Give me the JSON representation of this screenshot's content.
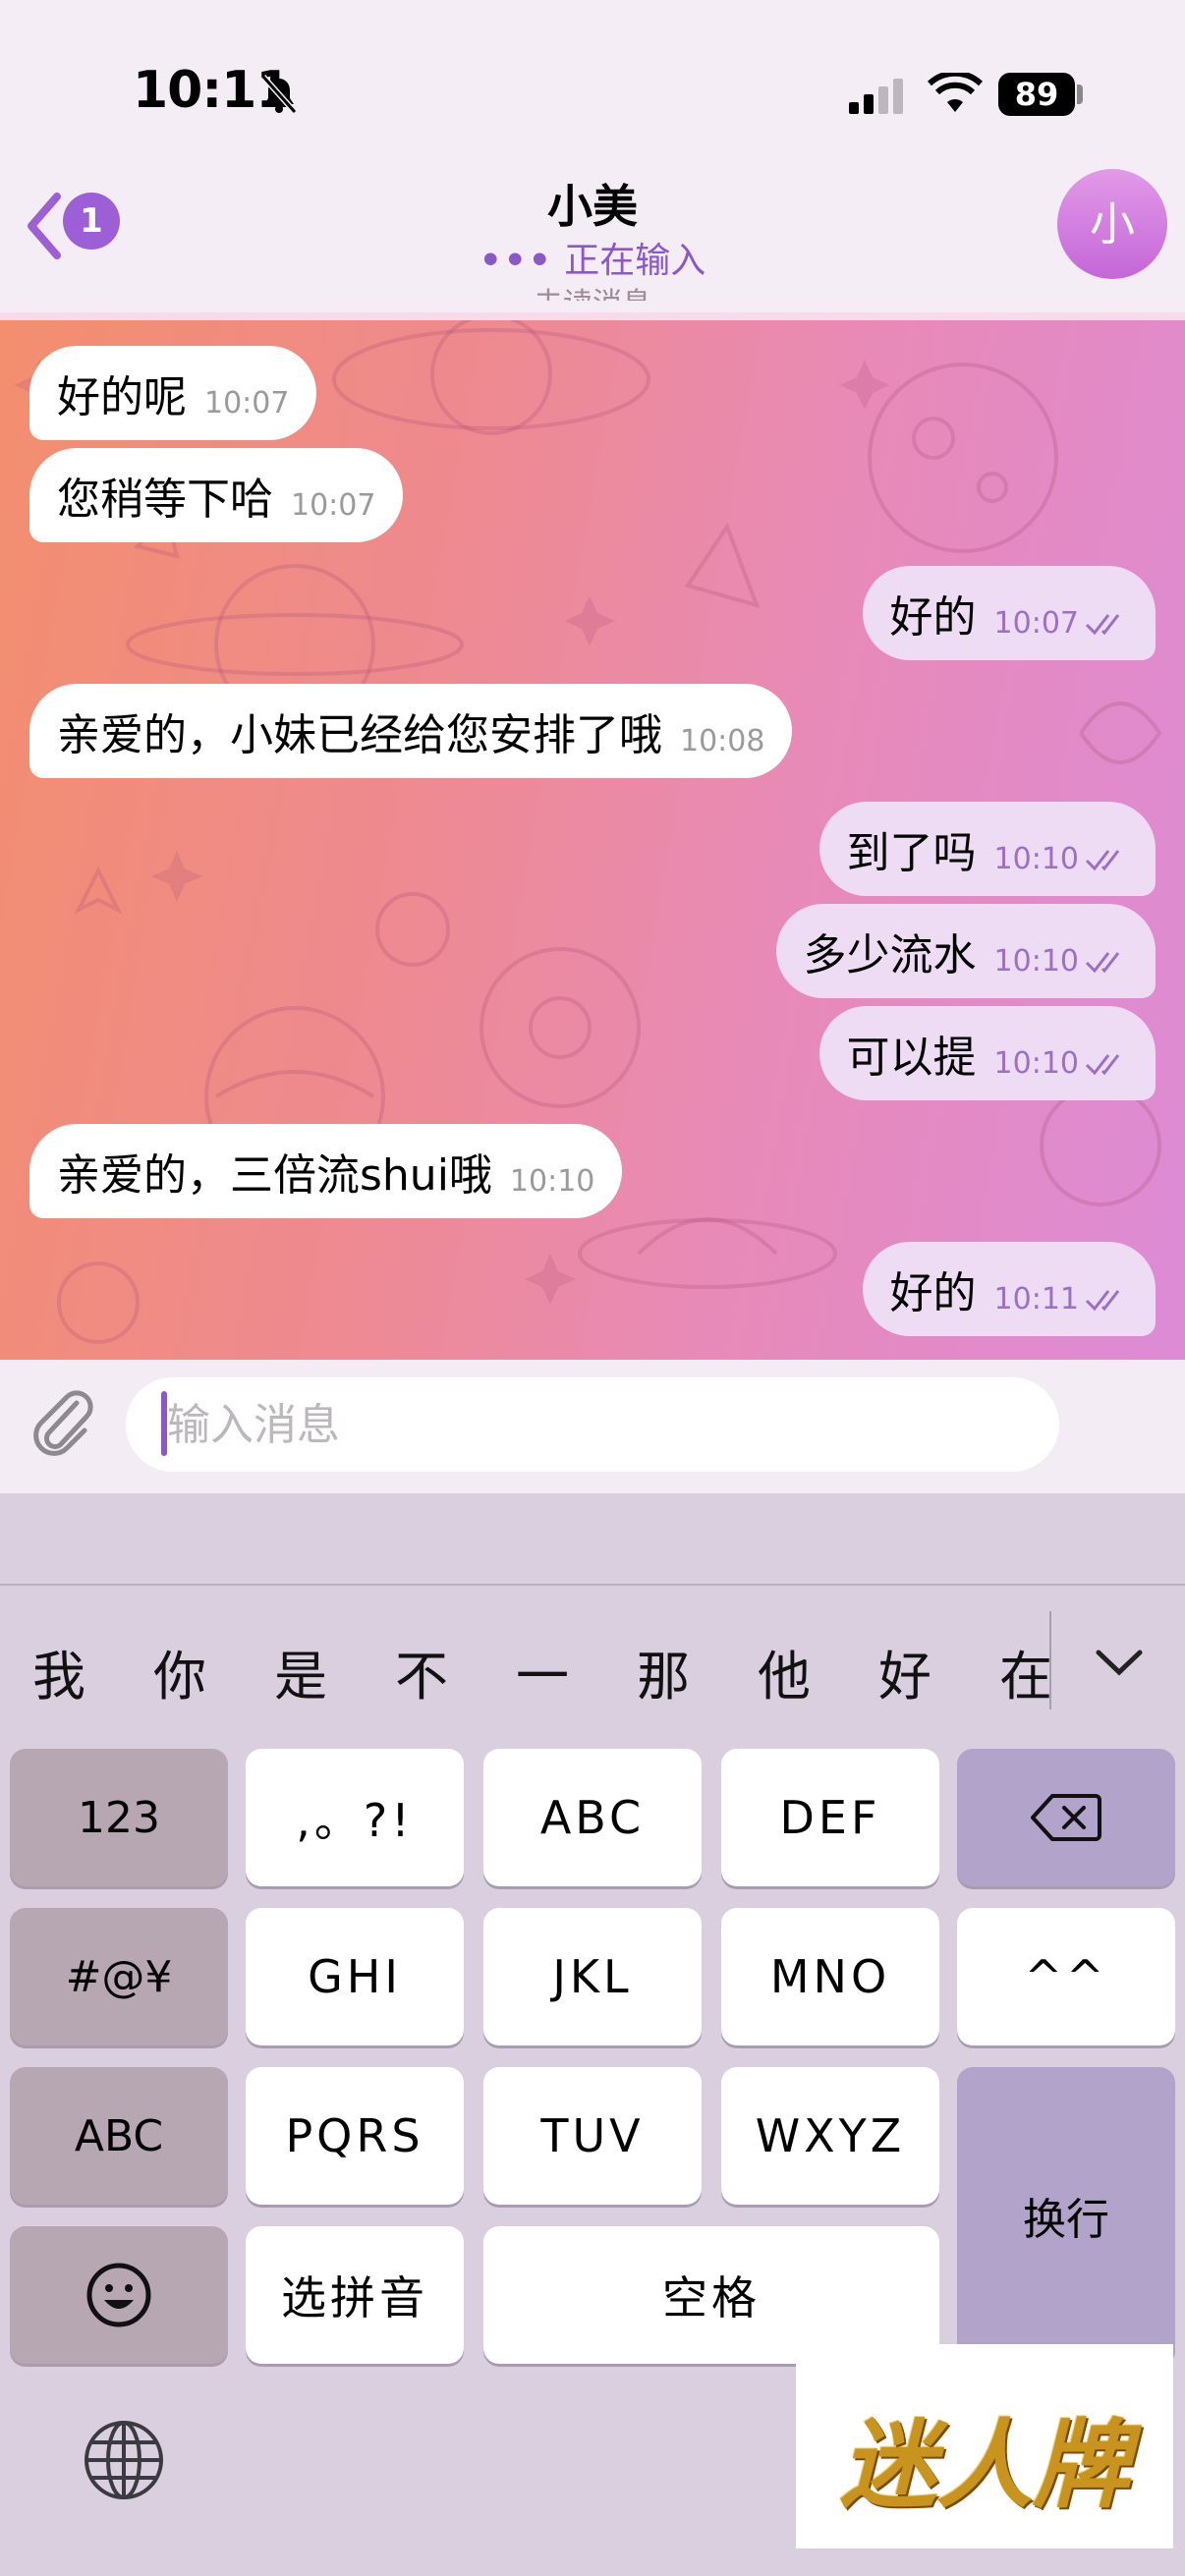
{
  "status_bar": {
    "time": "10:11",
    "battery": "89"
  },
  "header": {
    "back_badge": "1",
    "title": "小美",
    "subtitle": "正在输入",
    "avatar_initial": "小"
  },
  "chat": {
    "partial_top": "未读消息",
    "messages": [
      {
        "dir": "in",
        "text": "好的呢",
        "time": "10:07"
      },
      {
        "dir": "in",
        "text": "您稍等下哈",
        "time": "10:07"
      },
      {
        "dir": "out",
        "text": "好的",
        "time": "10:07"
      },
      {
        "dir": "in",
        "text": "亲爱的，小妹已经给您安排了哦",
        "time": "10:08"
      },
      {
        "dir": "out",
        "text": "到了吗",
        "time": "10:10"
      },
      {
        "dir": "out",
        "text": "多少流水",
        "time": "10:10"
      },
      {
        "dir": "out",
        "text": "可以提",
        "time": "10:10"
      },
      {
        "dir": "in",
        "text": "亲爱的，三倍流shui哦",
        "time": "10:10"
      },
      {
        "dir": "out",
        "text": "好的",
        "time": "10:11"
      }
    ]
  },
  "input": {
    "placeholder": "输入消息"
  },
  "keyboard": {
    "candidates": [
      "我",
      "你",
      "是",
      "不",
      "一",
      "那",
      "他",
      "好",
      "在"
    ],
    "keys": {
      "num": "123",
      "punct": ",。?!",
      "abc": "ABC",
      "def": "DEF",
      "symbols": "#@¥",
      "ghi": "GHI",
      "jkl": "JKL",
      "mno": "MNO",
      "emoticon": "^^",
      "abc_switch": "ABC",
      "pqrs": "PQRS",
      "tuv": "TUV",
      "wxyz": "WXYZ",
      "return": "换行",
      "pinyin": "选拼音",
      "space": "空格"
    }
  },
  "watermark": {
    "text": "迷人牌"
  },
  "colors": {
    "accent": "#9c5fd6",
    "outgoing_bubble": "#eedcf4",
    "incoming_bubble": "#ffffff"
  }
}
